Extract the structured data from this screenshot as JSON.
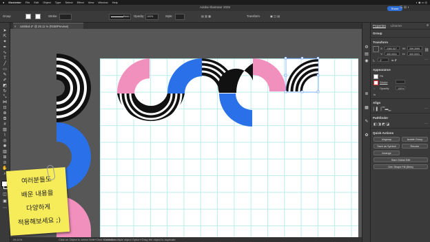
{
  "menubar": {
    "app": "Illustrator",
    "items": [
      "File",
      "Edit",
      "Object",
      "Type",
      "Select",
      "Effect",
      "View",
      "Window",
      "Help"
    ]
  },
  "titlebar": {
    "title": "Adobe Illustrator 2025",
    "share": "Share"
  },
  "control": {
    "selection_label": "Group",
    "stroke_label": "Stroke:",
    "brush_value": "Basic",
    "opacity_label": "Opacity:",
    "opacity_value": "100%",
    "style_label": "Style:",
    "transform_label": "Transform"
  },
  "document": {
    "tab": "Untitled-2* @ 29.11 % (RGB/Preview)"
  },
  "status": {
    "zoom": "29.11%",
    "hint": "Click on Object to select  Shift+Click to select multiple object  Option+Drag the object to duplicate",
    "selection": "Selection"
  },
  "panel": {
    "tabs": [
      "Properties",
      "Libraries"
    ],
    "group_label": "Group",
    "transform": {
      "heading": "Transform",
      "x": "2360.527",
      "y": "400.0001",
      "w": "399.3999",
      "h": "400.0001",
      "angle": "0°"
    },
    "appearance": {
      "heading": "Appearance",
      "fill": "Fill",
      "stroke": "Stroke",
      "opacity": "Opacity",
      "opacity_value": "100%"
    },
    "align": {
      "heading": "Align"
    },
    "pathfinder": {
      "heading": "Pathfinder"
    },
    "quick": {
      "heading": "Quick Actions",
      "ungroup": "Ungroup",
      "isolate": "Isolate Group",
      "save_symbol": "Save as Symbol",
      "recolor": "Recolor",
      "arrange": "Arrange",
      "global_edit": "Start Global Edit",
      "gen_fill": "Gen Shape Fill (Beta)"
    }
  },
  "sticky": {
    "lines": [
      "여러분들도",
      "배운 내용을",
      "다양하게",
      "적용해보세요 ;)"
    ]
  },
  "colors": {
    "pink": "#f18fbd",
    "blue": "#2a70e8",
    "black": "#111111",
    "accent": "#2f6fd6"
  }
}
